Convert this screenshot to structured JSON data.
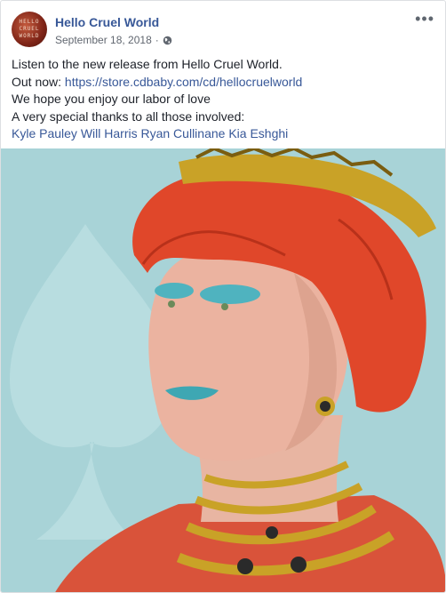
{
  "post": {
    "page_name": "Hello Cruel World",
    "avatar_text": "HELLO\nCRUEL\nWORLD",
    "date": "September 18, 2018",
    "separator": "·",
    "privacy_icon": "globe-icon",
    "more_icon": "more-horizontal-icon",
    "lines": {
      "line1": "Listen to the new release from Hello Cruel World.",
      "line2_prefix": "Out now: ",
      "line2_link": "https://store.cdbaby.com/cd/hellocruelworld",
      "line3": "We hope you enjoy our labor of love",
      "line4": "A very special thanks to all those involved:"
    },
    "tagged": [
      "Kyle Pauley",
      "Will Harris",
      "Ryan Cullinane",
      "Kia Eshghi"
    ]
  },
  "colors": {
    "link": "#385898",
    "text": "#1d2129",
    "meta": "#616770",
    "image_background": "#a8d3d7",
    "hair": "#e0472a",
    "crown": "#c9a227"
  }
}
